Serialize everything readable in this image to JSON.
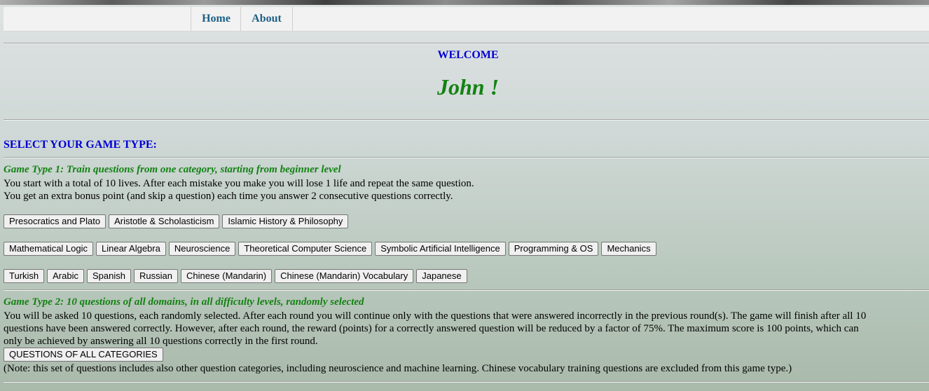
{
  "nav": {
    "items": [
      {
        "label": "Home"
      },
      {
        "label": "About"
      }
    ]
  },
  "welcome": {
    "heading": "WELCOME",
    "user": "John !"
  },
  "select_title": "SELECT YOUR GAME TYPE:",
  "game_type_1": {
    "title": "Game Type 1: Train questions from one category, starting from beginner level",
    "line1": "You start with a total of 10 lives. After each mistake you make you will lose 1 life and repeat the same question.",
    "line2": "You get an extra bonus point (and skip a question) each time you answer 2 consecutive questions correctly.",
    "philosophy": [
      "Presocratics and Plato",
      "Aristotle & Scholasticism",
      "Islamic History & Philosophy"
    ],
    "science": [
      "Mathematical Logic",
      "Linear Algebra",
      "Neuroscience",
      "Theoretical Computer Science",
      "Symbolic Artificial Intelligence",
      "Programming & OS",
      "Mechanics"
    ],
    "languages": [
      "Turkish",
      "Arabic",
      "Spanish",
      "Russian",
      "Chinese (Mandarin)",
      "Chinese (Mandarin) Vocabulary",
      "Japanese"
    ]
  },
  "game_type_2": {
    "title": "Game Type 2: 10 questions of all domains, in all difficulty levels, randomly selected",
    "description_line1": "You will be asked 10 questions, each randomly selected. After each round you will continue only with the questions that were answered incorrectly in the previous round(s). The game will finish after all 10",
    "description_line2": "questions have been answered correctly. However, after each round, the reward (points) for a correctly answered question will be reduced by a factor of 75%. The maximum score is 100 points, which can",
    "description_line3": "only be achieved by answering all 10 questions correctly in the first round.",
    "button": "QUESTIONS OF ALL CATEGORIES",
    "note": "(Note: this set of questions includes also other question categories, including neuroscience and machine learning. Chinese vocabulary training questions are excluded from this game type.)"
  }
}
